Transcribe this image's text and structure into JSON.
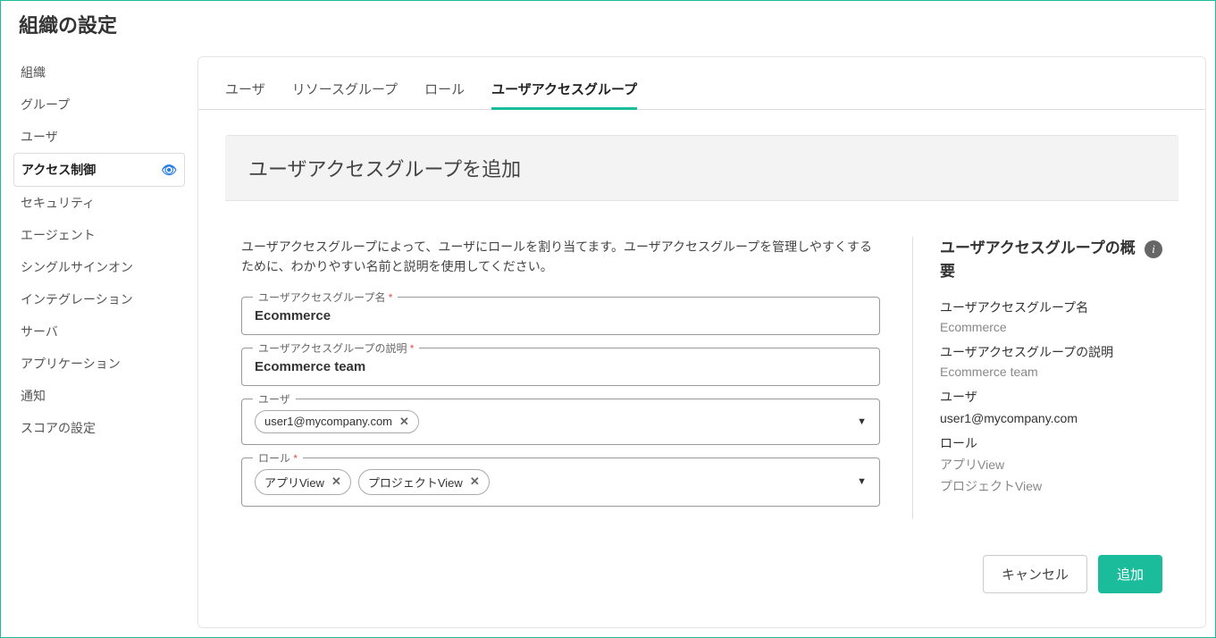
{
  "pageTitle": "組織の設定",
  "sidebar": {
    "items": [
      {
        "label": "組織"
      },
      {
        "label": "グループ"
      },
      {
        "label": "ユーザ"
      },
      {
        "label": "アクセス制御"
      },
      {
        "label": "セキュリティ"
      },
      {
        "label": "エージェント"
      },
      {
        "label": "シングルサインオン"
      },
      {
        "label": "インテグレーション"
      },
      {
        "label": "サーバ"
      },
      {
        "label": "アプリケーション"
      },
      {
        "label": "通知"
      },
      {
        "label": "スコアの設定"
      }
    ]
  },
  "tabs": {
    "items": [
      {
        "label": "ユーザ"
      },
      {
        "label": "リソースグループ"
      },
      {
        "label": "ロール"
      },
      {
        "label": "ユーザアクセスグループ"
      }
    ]
  },
  "panel": {
    "title": "ユーザアクセスグループを追加",
    "description": "ユーザアクセスグループによって、ユーザにロールを割り当てます。ユーザアクセスグループを管理しやすくするために、わかりやすい名前と説明を使用してください。"
  },
  "form": {
    "nameLabel": "ユーザアクセスグループ名",
    "nameValue": "Ecommerce",
    "descLabel": "ユーザアクセスグループの説明",
    "descValue": "Ecommerce team",
    "userLabel": "ユーザ",
    "userChips": [
      "user1@mycompany.com"
    ],
    "roleLabel": "ロール",
    "roleChips": [
      "アプリView",
      "プロジェクトView"
    ]
  },
  "summary": {
    "title": "ユーザアクセスグループの概要",
    "nameLabel": "ユーザアクセスグループ名",
    "nameValue": "Ecommerce",
    "descLabel": "ユーザアクセスグループの説明",
    "descValue": "Ecommerce team",
    "userLabel": "ユーザ",
    "userValue": "user1@mycompany.com",
    "roleLabel": "ロール",
    "roleValues": [
      "アプリView",
      "プロジェクトView"
    ]
  },
  "buttons": {
    "cancel": "キャンセル",
    "add": "追加"
  }
}
